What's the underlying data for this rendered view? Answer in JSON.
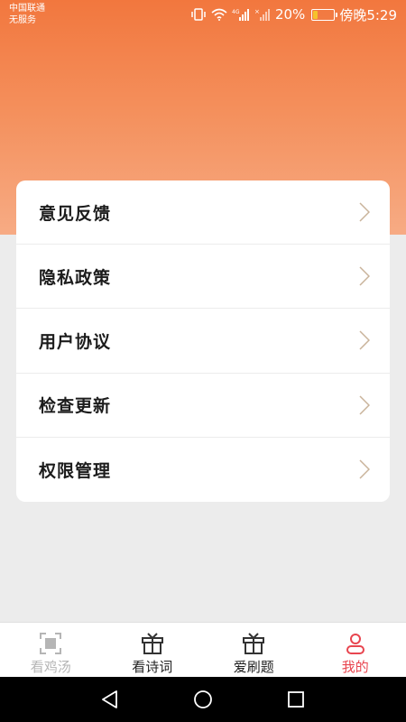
{
  "status_bar": {
    "carrier_line1": "中国联通",
    "carrier_line2": "无服务",
    "network": "4G",
    "battery_percent": "20%",
    "battery_level": 0.2,
    "time": "傍晚5:29"
  },
  "menu": {
    "items": [
      {
        "label": "意见反馈"
      },
      {
        "label": "隐私政策"
      },
      {
        "label": "用户协议"
      },
      {
        "label": "检查更新"
      },
      {
        "label": "权限管理"
      }
    ]
  },
  "tab_bar": {
    "tabs": [
      {
        "label": "看鸡汤",
        "icon": "scan-frame-icon",
        "state": "inactive"
      },
      {
        "label": "看诗词",
        "icon": "gift-box-icon",
        "state": "normal"
      },
      {
        "label": "爱刷题",
        "icon": "gift-box-icon",
        "state": "normal"
      },
      {
        "label": "我的",
        "icon": "person-icon",
        "state": "active"
      }
    ]
  },
  "colors": {
    "header_top": "#f2773e",
    "header_bottom": "#f7ab84",
    "active_tab": "#e8454f",
    "battery": "#f6c22b",
    "chevron": "#c9b39a"
  }
}
